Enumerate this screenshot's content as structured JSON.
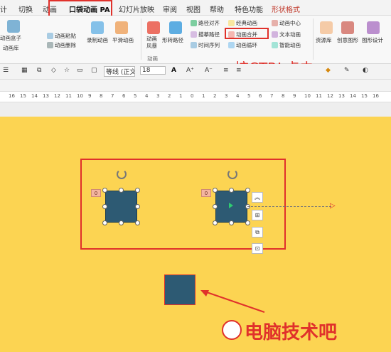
{
  "menu": {
    "tabs": [
      "计",
      "切换",
      "动画",
      "口袋动画 PA",
      "幻灯片放映",
      "审阅",
      "视图",
      "帮助",
      "特色功能",
      "形状格式"
    ]
  },
  "ribbon": {
    "col1": {
      "top": "动画盒子",
      "bottom": "动画库"
    },
    "col2": [
      "动画粘贴",
      "动画删除"
    ],
    "col3": [
      "录制动画",
      "平滑动画"
    ],
    "col4": {
      "label": "动画风暴"
    },
    "col5": "形转路径",
    "col6": [
      "路径对齐",
      "描摹路径",
      "时间序列"
    ],
    "col7": [
      "经典动画",
      "动画合并",
      "动画循环"
    ],
    "col8": [
      "动画中心",
      "文本动画",
      "智能动画"
    ],
    "col9": [
      "资源库",
      "创意图形",
      "图形设计"
    ],
    "group_label": "动画"
  },
  "formatbar": {
    "font": "等线 (正文)",
    "size": "18"
  },
  "ruler": {
    "labels": [
      "16",
      "15",
      "14",
      "13",
      "12",
      "11",
      "10",
      "9",
      "8",
      "7",
      "6",
      "5",
      "4",
      "3",
      "2",
      "1",
      "0",
      "1",
      "2",
      "3",
      "4",
      "5",
      "6",
      "7",
      "8",
      "9",
      "10",
      "11",
      "12",
      "13",
      "14",
      "15",
      "16"
    ]
  },
  "slide": {
    "tag_left": "0",
    "tag_right": "0",
    "annotation": "按CTRL点击",
    "watermark": "电脑技术吧"
  },
  "colors": {
    "accent": "#e0312b",
    "slide_bg": "#fcd452",
    "shape_fill": "#2d5a73"
  }
}
